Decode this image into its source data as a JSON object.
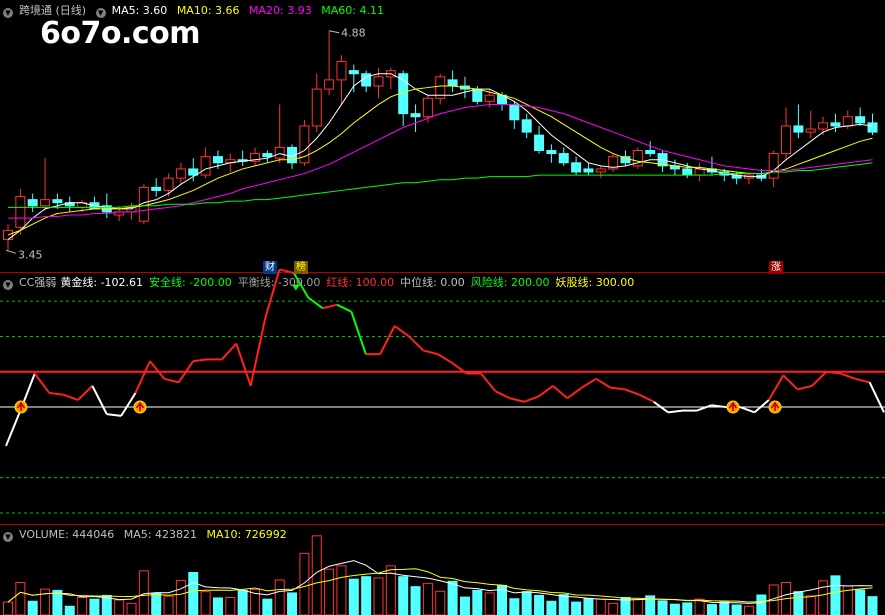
{
  "logo": "6o7o.com",
  "main_header": {
    "title": "跨境通 (日线)",
    "ma5": "MA5: 3.60",
    "ma10": "MA10: 3.66",
    "ma20": "MA20: 3.93",
    "ma60": "MA60: 4.11",
    "colors": {
      "ma5": "#ffffff",
      "ma10": "#ffff00",
      "ma20": "#ff00ff",
      "ma60": "#00ff00"
    }
  },
  "annotations": {
    "high": "4.88",
    "low": "3.45"
  },
  "tags": [
    {
      "text": "财",
      "bg": "#003a8c",
      "fg": "#ffffff"
    },
    {
      "text": "榜",
      "bg": "#7a5a00",
      "fg": "#ffff00"
    },
    {
      "text": "涨",
      "bg": "#a00000",
      "fg": "#ffffff"
    }
  ],
  "indicator_header": {
    "name": "CC强弱",
    "items": [
      {
        "label": "黄金线: -102.61",
        "color": "#ffffff"
      },
      {
        "label": "安全线: -200.00",
        "color": "#00ff00"
      },
      {
        "label": "平衡线: -300.00",
        "color": "#a0a0a0"
      },
      {
        "label": "红线: 100.00",
        "color": "#ff3030"
      },
      {
        "label": "中位线: 0.00",
        "color": "#c0c0c0"
      },
      {
        "label": "风险线: 200.00",
        "color": "#00ff00"
      },
      {
        "label": "妖股线: 300.00",
        "color": "#ffff00"
      }
    ]
  },
  "volume_header": {
    "volume": "VOLUME: 444046",
    "ma5": "MA5: 423821",
    "ma10": "MA10: 726992"
  },
  "chart_data": [
    {
      "type": "candlestick",
      "title": "跨境通 (日线)",
      "ylim": [
        3.4,
        4.95
      ],
      "candles": [
        {
          "o": 3.52,
          "h": 3.62,
          "l": 3.45,
          "c": 3.58
        },
        {
          "o": 3.6,
          "h": 3.85,
          "l": 3.55,
          "c": 3.8
        },
        {
          "o": 3.78,
          "h": 3.82,
          "l": 3.7,
          "c": 3.74
        },
        {
          "o": 3.74,
          "h": 4.05,
          "l": 3.71,
          "c": 3.78
        },
        {
          "o": 3.78,
          "h": 3.82,
          "l": 3.72,
          "c": 3.76
        },
        {
          "o": 3.76,
          "h": 3.8,
          "l": 3.7,
          "c": 3.74
        },
        {
          "o": 3.73,
          "h": 3.78,
          "l": 3.7,
          "c": 3.76
        },
        {
          "o": 3.76,
          "h": 3.8,
          "l": 3.72,
          "c": 3.72
        },
        {
          "o": 3.74,
          "h": 3.82,
          "l": 3.66,
          "c": 3.7
        },
        {
          "o": 3.68,
          "h": 3.74,
          "l": 3.64,
          "c": 3.7
        },
        {
          "o": 3.7,
          "h": 3.76,
          "l": 3.65,
          "c": 3.73
        },
        {
          "o": 3.64,
          "h": 3.88,
          "l": 3.62,
          "c": 3.86
        },
        {
          "o": 3.86,
          "h": 3.92,
          "l": 3.8,
          "c": 3.84
        },
        {
          "o": 3.84,
          "h": 3.95,
          "l": 3.8,
          "c": 3.92
        },
        {
          "o": 3.92,
          "h": 4.02,
          "l": 3.88,
          "c": 3.98
        },
        {
          "o": 3.98,
          "h": 4.05,
          "l": 3.9,
          "c": 3.94
        },
        {
          "o": 3.94,
          "h": 4.12,
          "l": 3.92,
          "c": 4.06
        },
        {
          "o": 4.06,
          "h": 4.1,
          "l": 3.98,
          "c": 4.02
        },
        {
          "o": 4.02,
          "h": 4.08,
          "l": 3.96,
          "c": 4.04
        },
        {
          "o": 4.04,
          "h": 4.1,
          "l": 4.0,
          "c": 4.03
        },
        {
          "o": 4.03,
          "h": 4.12,
          "l": 4.0,
          "c": 4.08
        },
        {
          "o": 4.08,
          "h": 4.1,
          "l": 4.02,
          "c": 4.06
        },
        {
          "o": 4.05,
          "h": 4.4,
          "l": 4.02,
          "c": 4.12
        },
        {
          "o": 4.12,
          "h": 4.14,
          "l": 3.98,
          "c": 4.02
        },
        {
          "o": 4.02,
          "h": 4.3,
          "l": 4.0,
          "c": 4.26
        },
        {
          "o": 4.26,
          "h": 4.6,
          "l": 4.22,
          "c": 4.5
        },
        {
          "o": 4.5,
          "h": 4.88,
          "l": 4.46,
          "c": 4.56
        },
        {
          "o": 4.56,
          "h": 4.72,
          "l": 4.4,
          "c": 4.68
        },
        {
          "o": 4.62,
          "h": 4.66,
          "l": 4.48,
          "c": 4.6
        },
        {
          "o": 4.6,
          "h": 4.62,
          "l": 4.48,
          "c": 4.52
        },
        {
          "o": 4.52,
          "h": 4.64,
          "l": 4.44,
          "c": 4.58
        },
        {
          "o": 4.58,
          "h": 4.64,
          "l": 4.5,
          "c": 4.62
        },
        {
          "o": 4.6,
          "h": 4.62,
          "l": 4.26,
          "c": 4.34
        },
        {
          "o": 4.34,
          "h": 4.4,
          "l": 4.22,
          "c": 4.32
        },
        {
          "o": 4.32,
          "h": 4.46,
          "l": 4.28,
          "c": 4.44
        },
        {
          "o": 4.44,
          "h": 4.6,
          "l": 4.4,
          "c": 4.58
        },
        {
          "o": 4.56,
          "h": 4.62,
          "l": 4.48,
          "c": 4.52
        },
        {
          "o": 4.52,
          "h": 4.58,
          "l": 4.44,
          "c": 4.5
        },
        {
          "o": 4.5,
          "h": 4.52,
          "l": 4.4,
          "c": 4.42
        },
        {
          "o": 4.42,
          "h": 4.5,
          "l": 4.38,
          "c": 4.46
        },
        {
          "o": 4.46,
          "h": 4.48,
          "l": 4.36,
          "c": 4.4
        },
        {
          "o": 4.4,
          "h": 4.42,
          "l": 4.24,
          "c": 4.3
        },
        {
          "o": 4.3,
          "h": 4.34,
          "l": 4.18,
          "c": 4.22
        },
        {
          "o": 4.2,
          "h": 4.26,
          "l": 4.08,
          "c": 4.1
        },
        {
          "o": 4.1,
          "h": 4.14,
          "l": 4.02,
          "c": 4.08
        },
        {
          "o": 4.08,
          "h": 4.12,
          "l": 4.0,
          "c": 4.02
        },
        {
          "o": 4.02,
          "h": 4.06,
          "l": 3.94,
          "c": 3.96
        },
        {
          "o": 3.98,
          "h": 4.02,
          "l": 3.94,
          "c": 3.96
        },
        {
          "o": 3.96,
          "h": 4.0,
          "l": 3.92,
          "c": 3.98
        },
        {
          "o": 3.98,
          "h": 4.08,
          "l": 3.96,
          "c": 4.06
        },
        {
          "o": 4.06,
          "h": 4.1,
          "l": 4.0,
          "c": 4.02
        },
        {
          "o": 4.0,
          "h": 4.12,
          "l": 3.98,
          "c": 4.1
        },
        {
          "o": 4.1,
          "h": 4.16,
          "l": 4.06,
          "c": 4.08
        },
        {
          "o": 4.08,
          "h": 4.1,
          "l": 3.96,
          "c": 4.0
        },
        {
          "o": 4.0,
          "h": 4.04,
          "l": 3.94,
          "c": 3.98
        },
        {
          "o": 3.98,
          "h": 4.02,
          "l": 3.92,
          "c": 3.94
        },
        {
          "o": 3.94,
          "h": 4.02,
          "l": 3.9,
          "c": 3.98
        },
        {
          "o": 3.98,
          "h": 4.06,
          "l": 3.94,
          "c": 3.96
        },
        {
          "o": 3.96,
          "h": 3.98,
          "l": 3.9,
          "c": 3.94
        },
        {
          "o": 3.94,
          "h": 3.96,
          "l": 3.88,
          "c": 3.92
        },
        {
          "o": 3.92,
          "h": 3.96,
          "l": 3.88,
          "c": 3.94
        },
        {
          "o": 3.94,
          "h": 3.98,
          "l": 3.9,
          "c": 3.92
        },
        {
          "o": 3.92,
          "h": 4.1,
          "l": 3.86,
          "c": 4.08
        },
        {
          "o": 4.08,
          "h": 4.38,
          "l": 4.04,
          "c": 4.26
        },
        {
          "o": 4.26,
          "h": 4.4,
          "l": 4.18,
          "c": 4.22
        },
        {
          "o": 4.22,
          "h": 4.36,
          "l": 4.18,
          "c": 4.24
        },
        {
          "o": 4.24,
          "h": 4.32,
          "l": 4.2,
          "c": 4.28
        },
        {
          "o": 4.28,
          "h": 4.34,
          "l": 4.22,
          "c": 4.26
        },
        {
          "o": 4.26,
          "h": 4.36,
          "l": 4.24,
          "c": 4.32
        },
        {
          "o": 4.32,
          "h": 4.38,
          "l": 4.26,
          "c": 4.28
        },
        {
          "o": 4.28,
          "h": 4.34,
          "l": 4.2,
          "c": 4.22
        }
      ],
      "ma": [
        {
          "name": "MA5",
          "color": "#ffffff",
          "values": [
            3.52,
            3.58,
            3.66,
            3.72,
            3.74,
            3.76,
            3.76,
            3.74,
            3.73,
            3.72,
            3.72,
            3.76,
            3.78,
            3.82,
            3.88,
            3.93,
            3.98,
            4.0,
            4.02,
            4.03,
            4.04,
            4.05,
            4.08,
            4.06,
            4.1,
            4.18,
            4.28,
            4.4,
            4.52,
            4.58,
            4.6,
            4.6,
            4.56,
            4.5,
            4.46,
            4.46,
            4.46,
            4.48,
            4.5,
            4.5,
            4.46,
            4.42,
            4.36,
            4.28,
            4.2,
            4.14,
            4.08,
            4.02,
            4.0,
            3.99,
            4.0,
            4.02,
            4.04,
            4.04,
            4.02,
            4.0,
            3.98,
            3.97,
            3.95,
            3.94,
            3.93,
            3.93,
            3.97,
            4.04,
            4.1,
            4.16,
            4.22,
            4.25,
            4.26,
            4.27,
            4.26
          ]
        },
        {
          "name": "MA10",
          "color": "#ffff00",
          "values": [
            3.55,
            3.58,
            3.62,
            3.66,
            3.69,
            3.7,
            3.71,
            3.72,
            3.72,
            3.72,
            3.73,
            3.74,
            3.76,
            3.78,
            3.81,
            3.84,
            3.88,
            3.92,
            3.95,
            3.98,
            4.0,
            4.02,
            4.04,
            4.04,
            4.06,
            4.1,
            4.15,
            4.21,
            4.28,
            4.34,
            4.4,
            4.45,
            4.48,
            4.5,
            4.51,
            4.52,
            4.52,
            4.51,
            4.5,
            4.48,
            4.46,
            4.44,
            4.4,
            4.36,
            4.32,
            4.27,
            4.22,
            4.17,
            4.12,
            4.08,
            4.05,
            4.03,
            4.02,
            4.01,
            4.0,
            3.99,
            3.99,
            3.98,
            3.97,
            3.96,
            3.95,
            3.95,
            3.96,
            3.98,
            4.01,
            4.04,
            4.07,
            4.1,
            4.13,
            4.16,
            4.18
          ]
        },
        {
          "name": "MA20",
          "color": "#ff00ff",
          "values": [
            3.66,
            3.66,
            3.66,
            3.67,
            3.67,
            3.68,
            3.68,
            3.69,
            3.69,
            3.7,
            3.7,
            3.71,
            3.72,
            3.73,
            3.74,
            3.76,
            3.78,
            3.8,
            3.82,
            3.85,
            3.87,
            3.89,
            3.91,
            3.93,
            3.95,
            3.98,
            4.01,
            4.05,
            4.09,
            4.13,
            4.17,
            4.21,
            4.25,
            4.28,
            4.31,
            4.34,
            4.36,
            4.38,
            4.39,
            4.4,
            4.4,
            4.4,
            4.39,
            4.38,
            4.36,
            4.34,
            4.31,
            4.28,
            4.25,
            4.22,
            4.19,
            4.16,
            4.13,
            4.1,
            4.08,
            4.06,
            4.04,
            4.02,
            4.0,
            3.99,
            3.98,
            3.97,
            3.97,
            3.97,
            3.98,
            3.99,
            4.0,
            4.01,
            4.02,
            4.03,
            4.04
          ]
        },
        {
          "name": "MA60",
          "color": "#00ff00",
          "values": [
            3.73,
            3.73,
            3.73,
            3.73,
            3.73,
            3.73,
            3.73,
            3.73,
            3.73,
            3.73,
            3.74,
            3.74,
            3.74,
            3.75,
            3.75,
            3.75,
            3.76,
            3.76,
            3.77,
            3.77,
            3.78,
            3.78,
            3.79,
            3.8,
            3.81,
            3.82,
            3.83,
            3.84,
            3.85,
            3.86,
            3.87,
            3.88,
            3.89,
            3.89,
            3.9,
            3.91,
            3.91,
            3.92,
            3.92,
            3.93,
            3.93,
            3.93,
            3.93,
            3.94,
            3.94,
            3.94,
            3.94,
            3.94,
            3.94,
            3.94,
            3.94,
            3.94,
            3.94,
            3.94,
            3.94,
            3.94,
            3.94,
            3.94,
            3.95,
            3.95,
            3.95,
            3.95,
            3.96,
            3.96,
            3.97,
            3.97,
            3.98,
            3.99,
            4.0,
            4.01,
            4.02
          ]
        }
      ],
      "high_label": "4.88",
      "low_label": "3.45"
    },
    {
      "type": "line",
      "title": "CC强弱",
      "ylim": [
        -320,
        360
      ],
      "reference_lines": [
        {
          "name": "妖股线",
          "value": 300,
          "color": "#00c000",
          "style": "dashed"
        },
        {
          "name": "风险线",
          "value": 200,
          "color": "#00c000",
          "style": "dashed"
        },
        {
          "name": "红线",
          "value": 100,
          "color": "#ff2020",
          "style": "solid"
        },
        {
          "name": "中位线",
          "value": 0,
          "color": "#ffffff",
          "style": "solid"
        },
        {
          "name": "安全线",
          "value": -200,
          "color": "#00c000",
          "style": "dashed"
        },
        {
          "name": "平衡线",
          "value": -300,
          "color": "#00c000",
          "style": "dashed"
        }
      ],
      "series": [
        {
          "name": "黄金线",
          "values": [
            -110,
            -10,
            95,
            40,
            35,
            20,
            60,
            -20,
            -25,
            40,
            130,
            80,
            70,
            130,
            135,
            135,
            180,
            60,
            250,
            390,
            380,
            310,
            280,
            290,
            270,
            150,
            150,
            230,
            200,
            160,
            150,
            125,
            95,
            95,
            45,
            25,
            15,
            30,
            60,
            25,
            55,
            80,
            55,
            50,
            35,
            15,
            -15,
            -10,
            -10,
            5,
            0,
            0,
            -15,
            20,
            90,
            50,
            60,
            100,
            95,
            80,
            70,
            -15
          ]
        }
      ],
      "signal_points": [
        1,
        10,
        58,
        62
      ]
    },
    {
      "type": "bar",
      "title": "VOLUME",
      "ylim": [
        0,
        1800000
      ],
      "values": [
        310000,
        780000,
        330000,
        620000,
        590000,
        210000,
        420000,
        380000,
        470000,
        360000,
        280000,
        1060000,
        520000,
        450000,
        830000,
        1020000,
        560000,
        410000,
        420000,
        590000,
        610000,
        380000,
        840000,
        530000,
        1480000,
        1900000,
        1100000,
        1180000,
        860000,
        920000,
        890000,
        1180000,
        920000,
        680000,
        760000,
        570000,
        810000,
        430000,
        590000,
        530000,
        710000,
        390000,
        560000,
        470000,
        330000,
        490000,
        310000,
        400000,
        380000,
        280000,
        420000,
        370000,
        460000,
        340000,
        260000,
        290000,
        380000,
        250000,
        310000,
        240000,
        210000,
        480000,
        720000,
        780000,
        560000,
        460000,
        820000,
        940000,
        700000,
        600000,
        440000
      ],
      "ma": [
        {
          "name": "MA5",
          "color": "#ffffff"
        },
        {
          "name": "MA10",
          "color": "#ffff00"
        }
      ]
    }
  ]
}
